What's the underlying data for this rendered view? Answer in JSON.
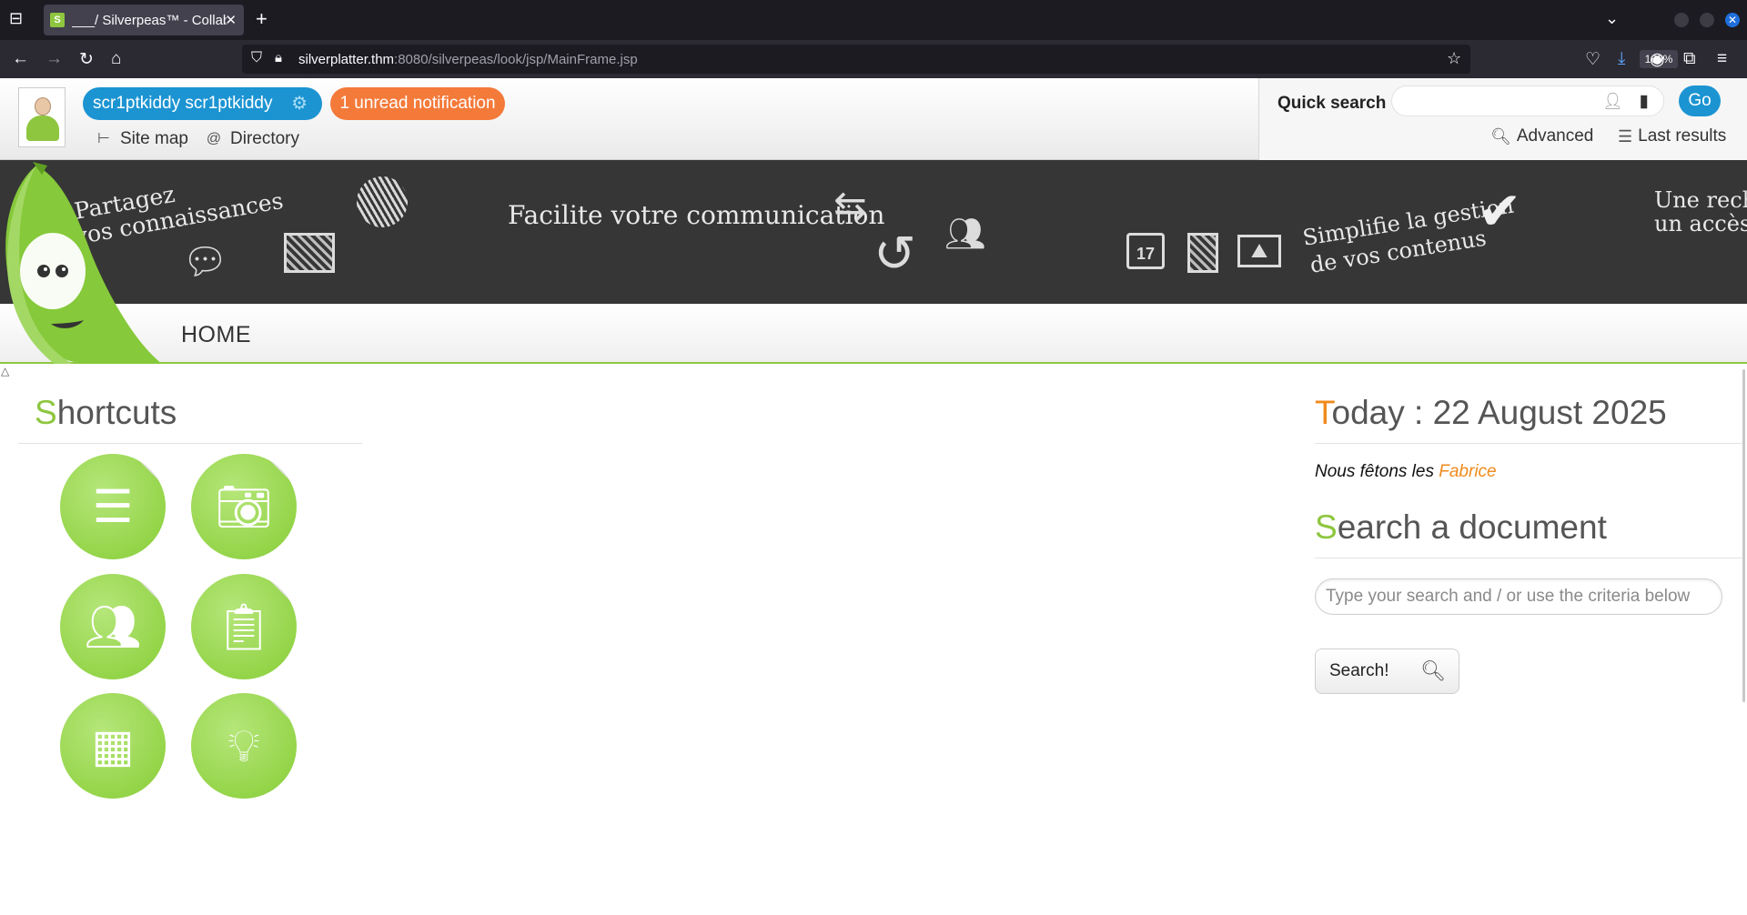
{
  "browser": {
    "tab_title": "___/ Silverpeas™ - Collab",
    "tab_favicon": "S",
    "url_host": "silverplatter.thm",
    "url_rest": ":8080/silverpeas/look/jsp/MainFrame.jsp",
    "zoom": "160%"
  },
  "header": {
    "user_name": "scr1ptkiddy scr1ptkiddy",
    "notification": "1 unread notification",
    "site_map": "Site map",
    "directory": "Directory",
    "quick_search_label": "Quick search",
    "go_label": "Go",
    "advanced": "Advanced",
    "last_results": "Last results"
  },
  "banner": {
    "text_share_1": "Partagez",
    "text_share_2": "vos connaissances",
    "text_comm": "Facilite votre communication",
    "text_gest_1": "Simplifie la gestion",
    "text_gest_2": "de vos contenus",
    "text_right_1": "Une rech",
    "text_right_2": "un accès",
    "calendar_day": "17"
  },
  "menu": {
    "home": "HOME"
  },
  "shortcuts": {
    "title_first": "S",
    "title_rest": "hortcuts"
  },
  "today": {
    "title_first": "T",
    "title_rest": "oday : 22 August 2025",
    "feast_prefix": "Nous fêtons les",
    "feast_name": "Fabrice"
  },
  "doc_search": {
    "title_first": "S",
    "title_rest": "earch a document",
    "placeholder": "Type your search and / or use the criteria below",
    "button_label": "Search!"
  },
  "colors": {
    "accent_green": "#8ec63f",
    "accent_blue": "#1c94d2",
    "accent_orange": "#f47a3a",
    "title_orange": "#f08a1c"
  }
}
